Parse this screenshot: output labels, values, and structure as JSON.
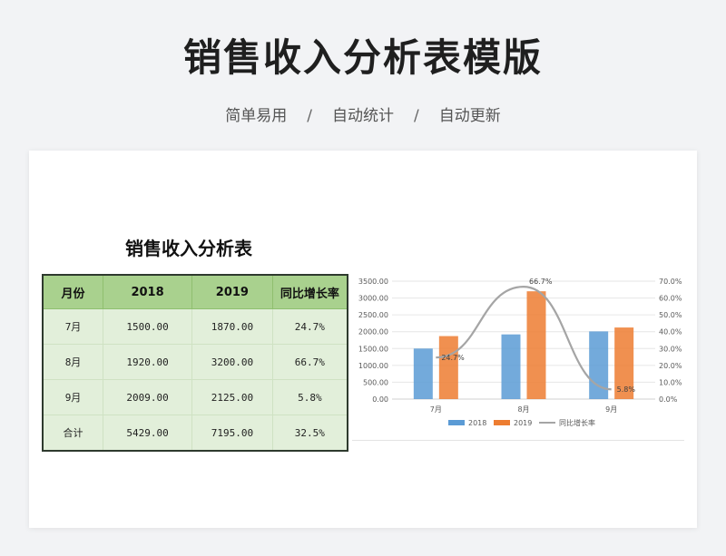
{
  "header": {
    "title": "销售收入分析表模版",
    "features": [
      "简单易用",
      "自动统计",
      "自动更新"
    ],
    "separator": "/"
  },
  "sheet": {
    "title": "销售收入分析表",
    "columns": [
      "月份",
      "2018",
      "2019",
      "同比增长率"
    ],
    "rows": [
      [
        "7月",
        "1500.00",
        "1870.00",
        "24.7%"
      ],
      [
        "8月",
        "1920.00",
        "3200.00",
        "66.7%"
      ],
      [
        "9月",
        "2009.00",
        "2125.00",
        "5.8%"
      ],
      [
        "合计",
        "5429.00",
        "7195.00",
        "32.5%"
      ]
    ]
  },
  "chart_data": {
    "type": "bar",
    "categories": [
      "7月",
      "8月",
      "9月"
    ],
    "series": [
      {
        "name": "2018",
        "kind": "bar",
        "axis": "left",
        "color": "#5b9bd5",
        "values": [
          1500,
          1920,
          2009
        ]
      },
      {
        "name": "2019",
        "kind": "bar",
        "axis": "left",
        "color": "#ed7d31",
        "values": [
          1870,
          3200,
          2125
        ]
      },
      {
        "name": "同比增长率",
        "kind": "line",
        "axis": "right",
        "color": "#a5a5a5",
        "values": [
          0.247,
          0.667,
          0.058
        ],
        "labels": [
          "24.7%",
          "66.7%",
          "5.8%"
        ]
      }
    ],
    "y_left": {
      "min": 0,
      "max": 3500,
      "ticks": [
        "0.00",
        "500.00",
        "1000.00",
        "1500.00",
        "2000.00",
        "2500.00",
        "3000.00",
        "3500.00"
      ]
    },
    "y_right": {
      "min": 0,
      "max": 0.7,
      "ticks": [
        "0.0%",
        "10.0%",
        "20.0%",
        "30.0%",
        "40.0%",
        "50.0%",
        "60.0%",
        "70.0%"
      ]
    },
    "grid": true,
    "legend": "bottom"
  }
}
